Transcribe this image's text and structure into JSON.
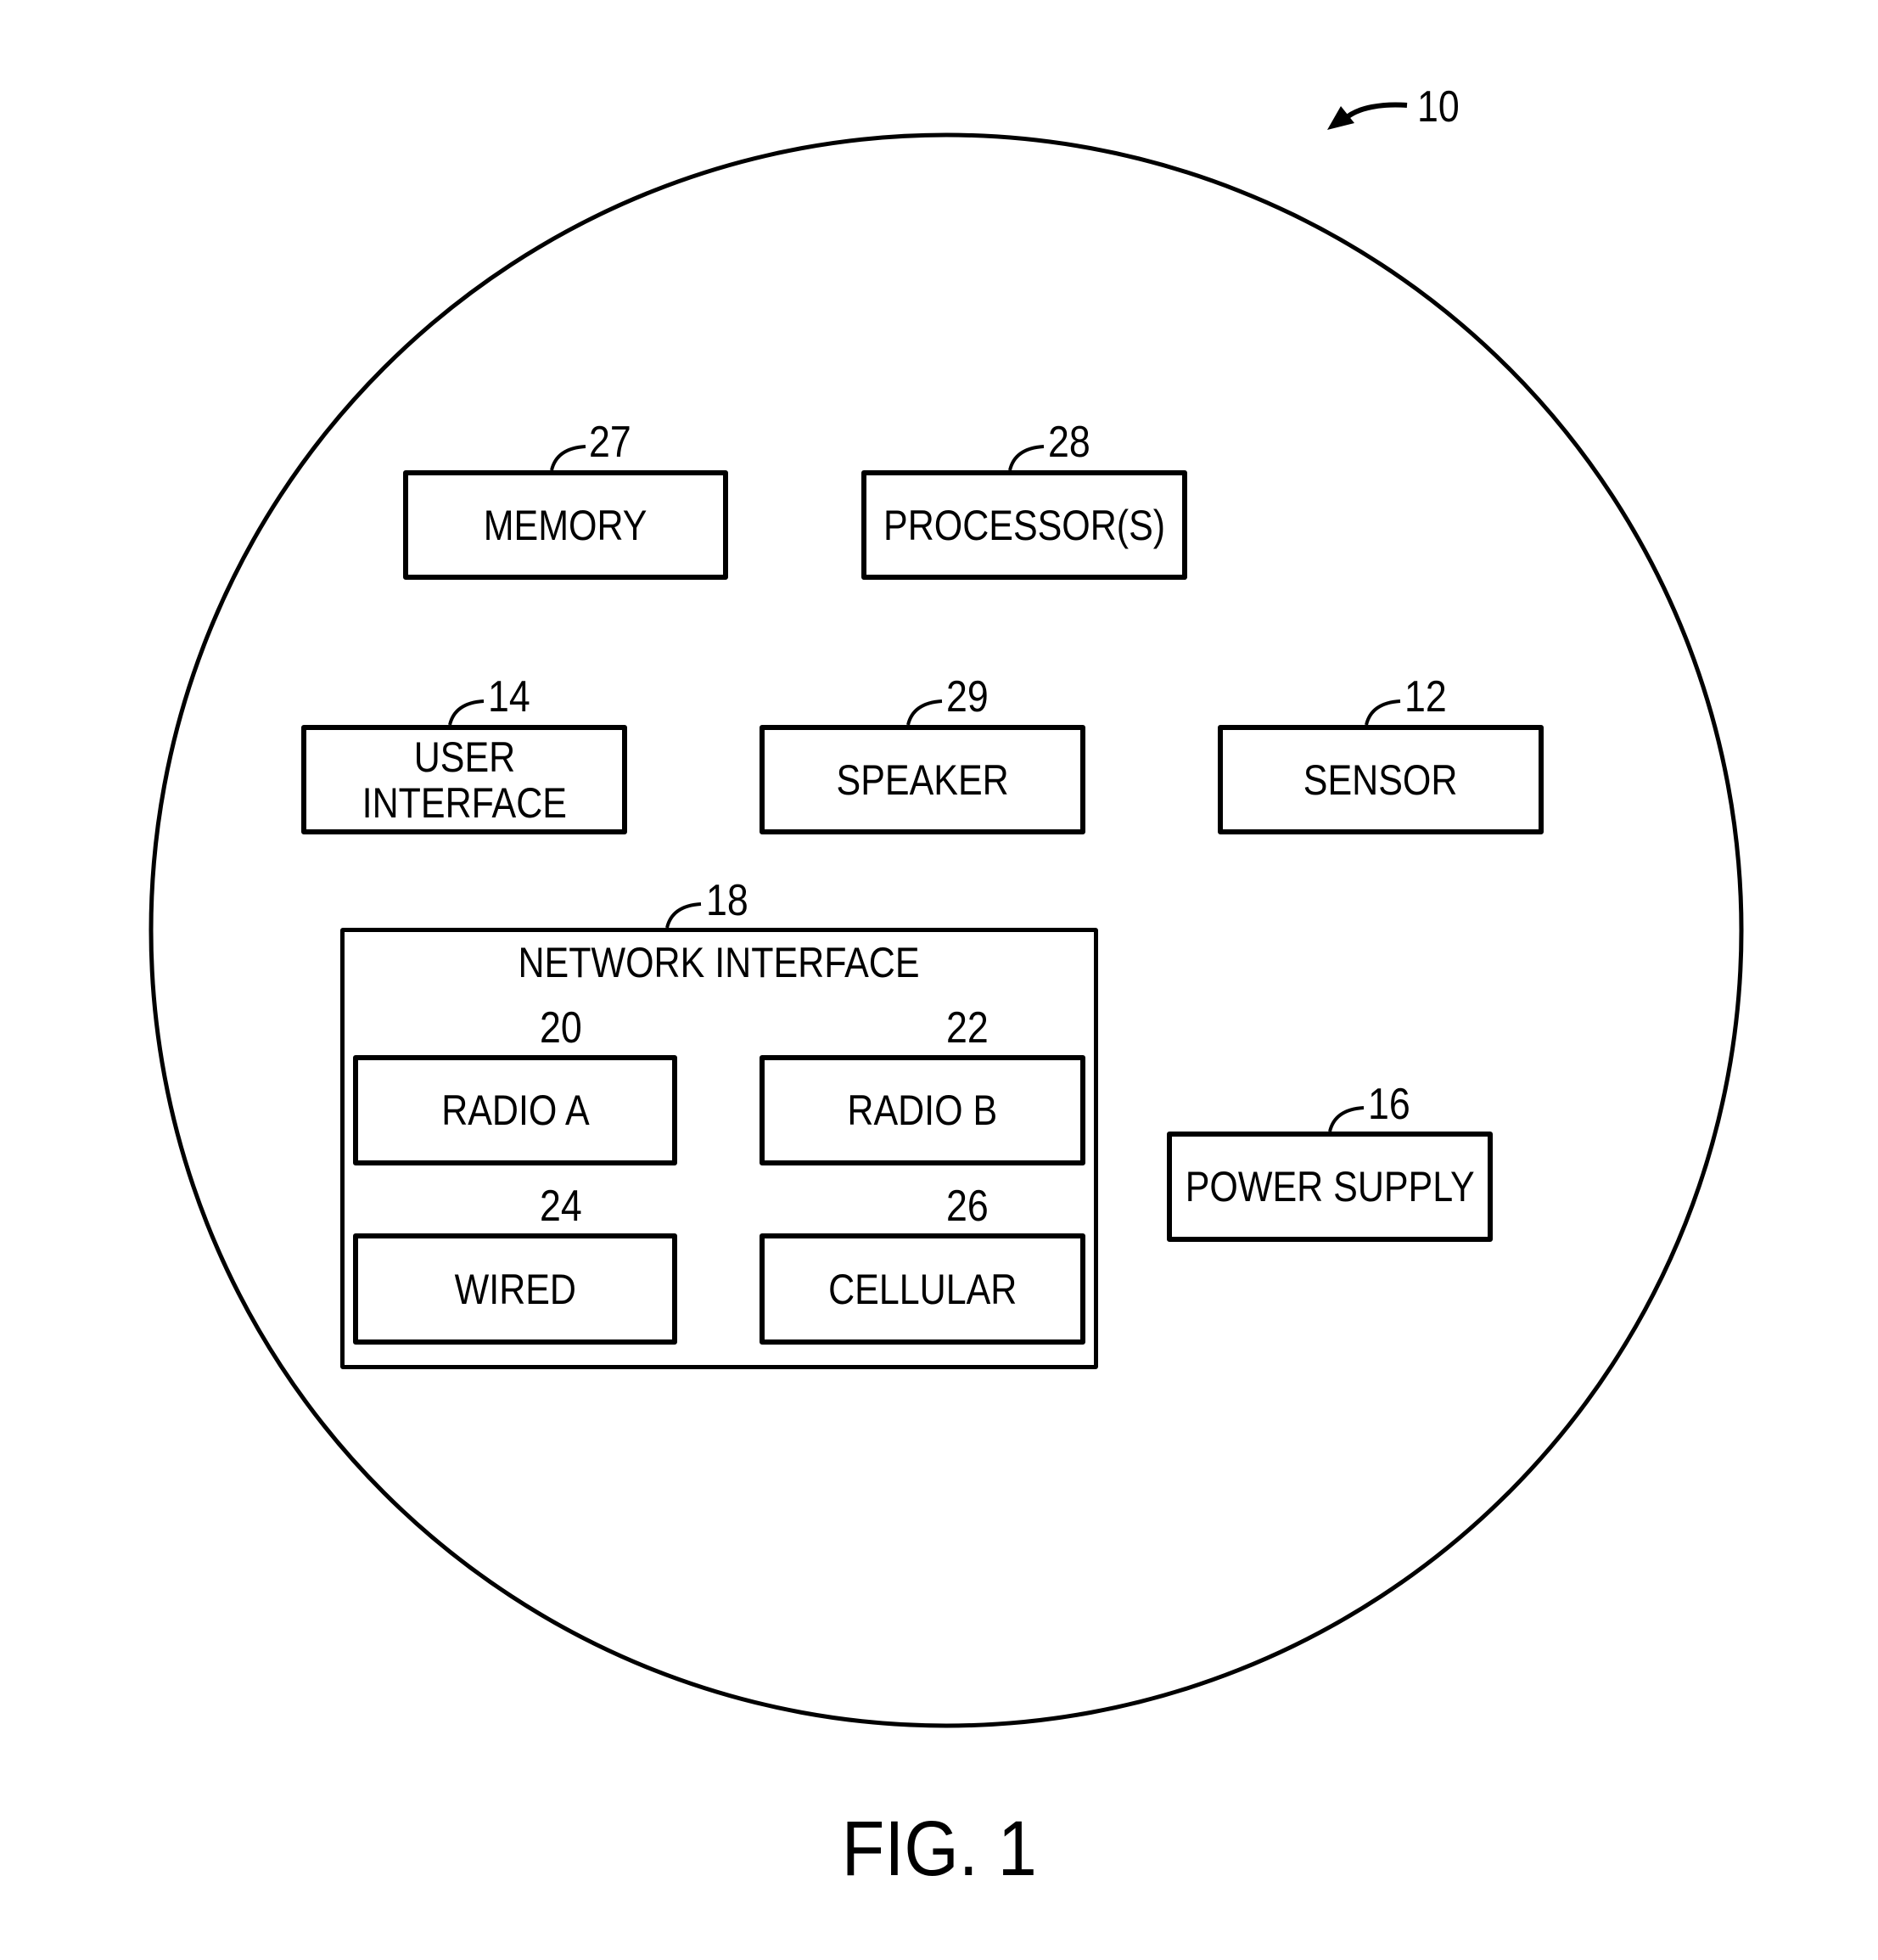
{
  "figure": {
    "caption": "FIG. 1",
    "device_ref": "10",
    "device_shape": "circle"
  },
  "components": {
    "memory": {
      "label": "MEMORY",
      "ref": "27"
    },
    "processor": {
      "label": "PROCESSOR(S)",
      "ref": "28"
    },
    "user_interface": {
      "label_line1": "USER",
      "label_line2": "INTERFACE",
      "ref": "14"
    },
    "speaker": {
      "label": "SPEAKER",
      "ref": "29"
    },
    "sensor": {
      "label": "SENSOR",
      "ref": "12"
    },
    "network_interface": {
      "label": "NETWORK INTERFACE",
      "ref": "18",
      "children": {
        "radio_a": {
          "label": "RADIO A",
          "ref": "20"
        },
        "radio_b": {
          "label": "RADIO B",
          "ref": "22"
        },
        "wired": {
          "label": "WIRED",
          "ref": "24"
        },
        "cellular": {
          "label": "CELLULAR",
          "ref": "26"
        }
      }
    },
    "power_supply": {
      "label": "POWER SUPPLY",
      "ref": "16"
    }
  },
  "colors": {
    "line": "#000000",
    "background": "#ffffff"
  }
}
